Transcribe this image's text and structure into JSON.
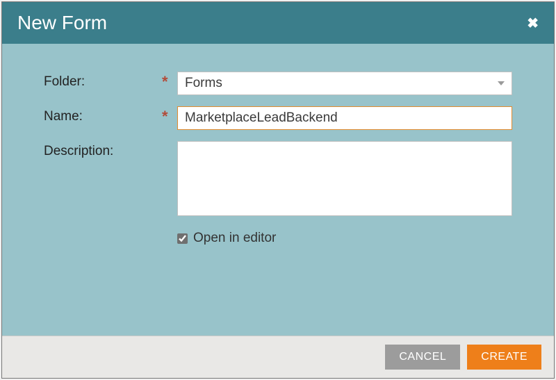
{
  "dialog": {
    "title": "New Form",
    "fields": {
      "folder": {
        "label": "Folder:",
        "value": "Forms",
        "required": true
      },
      "name": {
        "label": "Name:",
        "value": "MarketplaceLeadBackend",
        "required": true
      },
      "description": {
        "label": "Description:",
        "value": "",
        "required": false
      }
    },
    "openInEditor": {
      "label": "Open in editor",
      "checked": true
    },
    "buttons": {
      "cancel": "CANCEL",
      "create": "CREATE"
    }
  }
}
